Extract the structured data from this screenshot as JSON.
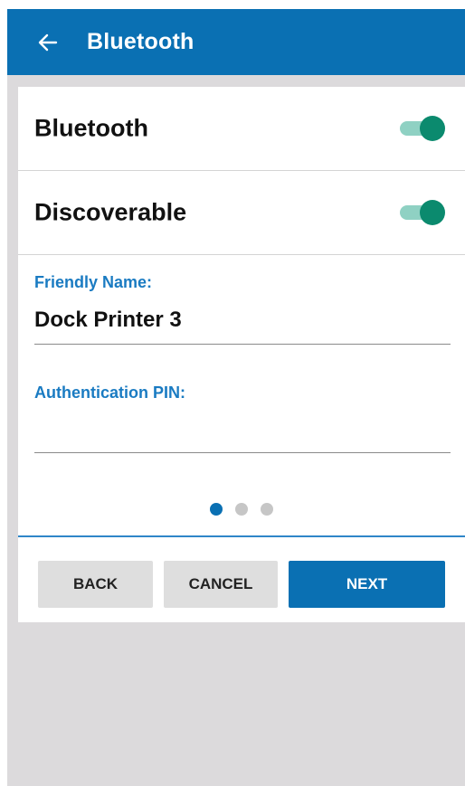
{
  "appbar": {
    "title": "Bluetooth",
    "back_icon": "arrow-left-icon"
  },
  "settings": {
    "bluetooth": {
      "label": "Bluetooth",
      "enabled": true
    },
    "discoverable": {
      "label": "Discoverable",
      "enabled": true
    }
  },
  "fields": {
    "friendly_name": {
      "label": "Friendly Name:",
      "value": "Dock Printer 3"
    },
    "auth_pin": {
      "label": "Authentication PIN:",
      "value": ""
    }
  },
  "pager": {
    "current": 1,
    "total": 3
  },
  "buttons": {
    "back": "BACK",
    "cancel": "CANCEL",
    "next": "NEXT"
  },
  "colors": {
    "primary": "#0a70b3",
    "label_blue": "#1a7bc2",
    "toggle_thumb": "#0b8a6e",
    "toggle_track": "#8fd1c3"
  }
}
